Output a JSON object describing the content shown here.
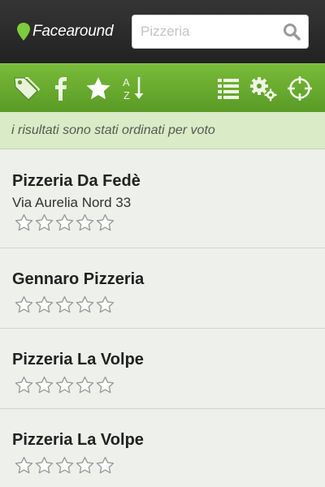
{
  "header": {
    "logo_text": "Facearound",
    "search": {
      "placeholder": "Pizzeria",
      "value": ""
    }
  },
  "toolbar": {
    "items": [
      {
        "name": "tag-icon"
      },
      {
        "name": "facebook-icon"
      },
      {
        "name": "star-icon",
        "active": true
      },
      {
        "name": "sort-az-icon",
        "text": "A Z"
      },
      {
        "name": "list-icon"
      },
      {
        "name": "gears-icon"
      },
      {
        "name": "crosshair-icon"
      }
    ]
  },
  "notice": "i risultati sono stati ordinati per voto",
  "results": [
    {
      "name": "Pizzeria Da Fedè",
      "address": "Via Aurelia Nord 33",
      "rating": 0
    },
    {
      "name": "Gennaro Pizzeria",
      "rating": 0
    },
    {
      "name": "Pizzeria La Volpe",
      "rating": 0
    },
    {
      "name": "Pizzeria La Volpe",
      "rating": 0
    }
  ],
  "colors": {
    "header": "#2a2a2a",
    "toolbar_green": "#6aad2f",
    "logo_pin": "#7ccc3c",
    "notice_bg": "#d9ebc7",
    "star_outline": "#9a9a9a"
  }
}
